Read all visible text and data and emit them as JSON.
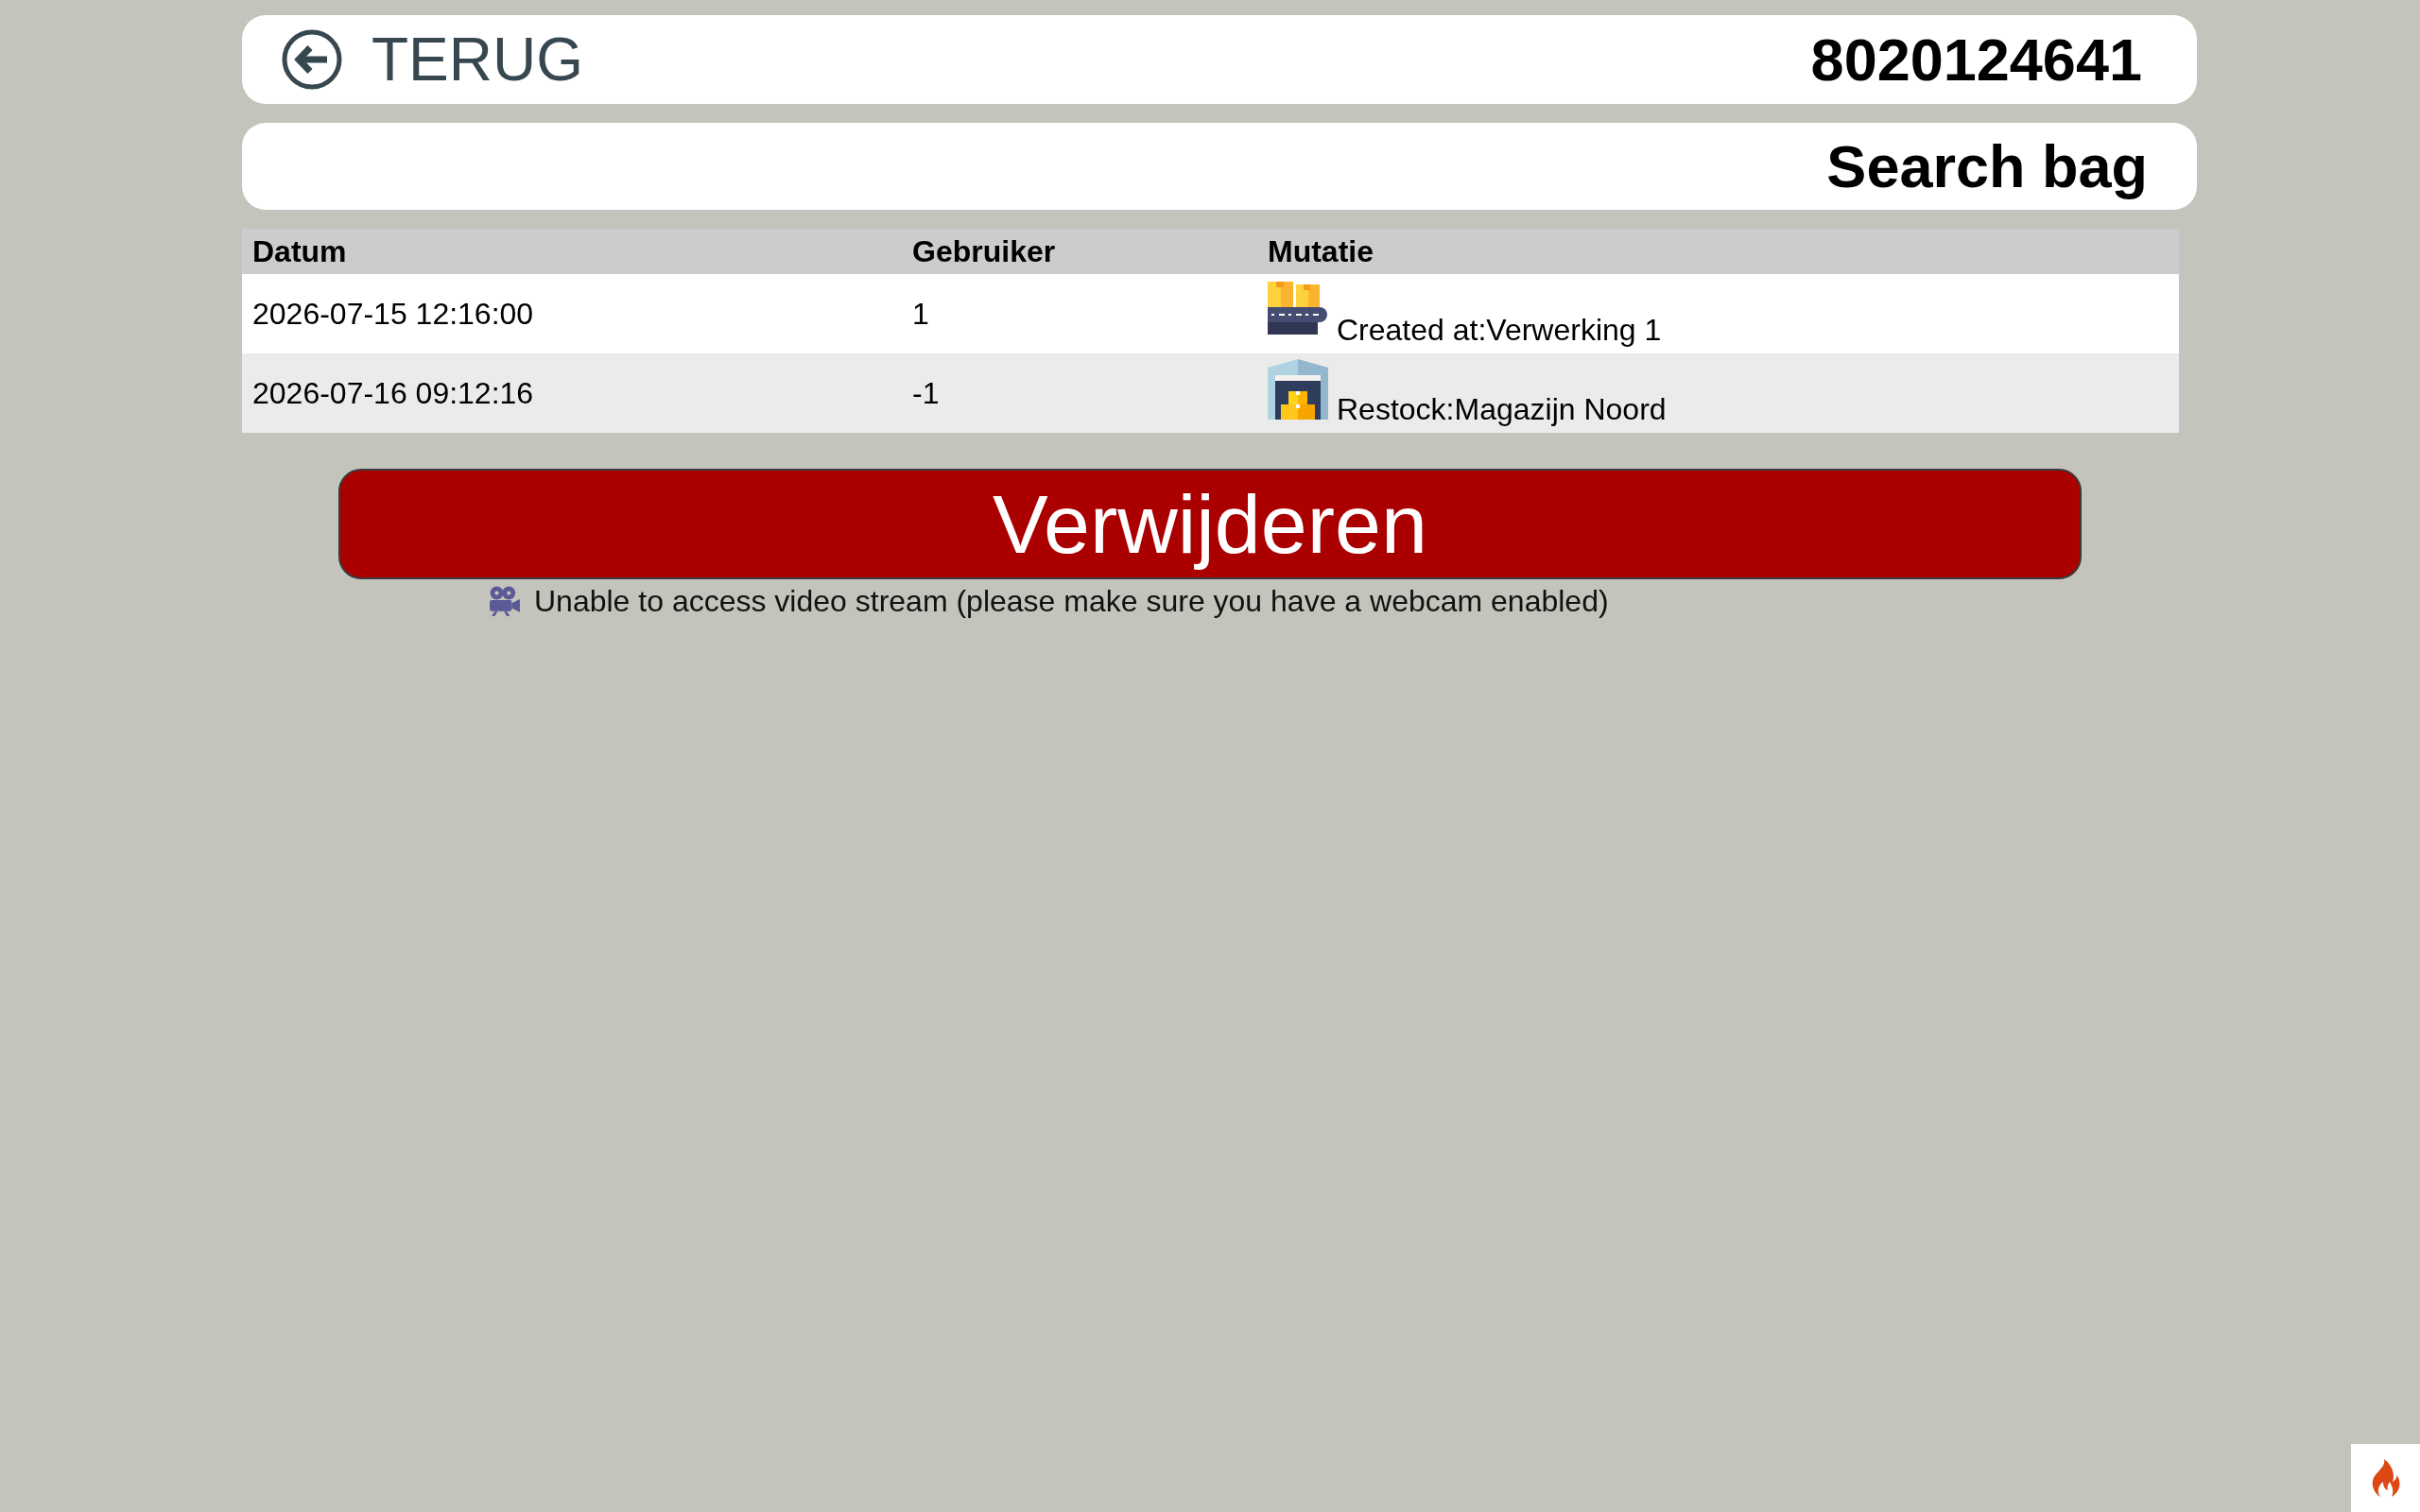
{
  "header": {
    "back_label": "TERUG",
    "bag_number": "8020124641"
  },
  "title": "Search bag",
  "table": {
    "columns": [
      "Datum",
      "Gebruiker",
      "Mutatie"
    ],
    "rows": [
      {
        "datum": "2026-07-15 12:16:00",
        "gebruiker": "1",
        "mutatie": {
          "kind": "conveyor",
          "text": "Created at:Verwerking 1"
        }
      },
      {
        "datum": "2026-07-16 09:12:16",
        "gebruiker": "-1",
        "mutatie": {
          "kind": "warehouse",
          "text": "Restock:Magazijn Noord"
        }
      }
    ]
  },
  "delete_button": {
    "label": "Verwijderen"
  },
  "camera_notice": {
    "text": "Unable to access video stream (please make sure you have a webcam enabled)"
  }
}
